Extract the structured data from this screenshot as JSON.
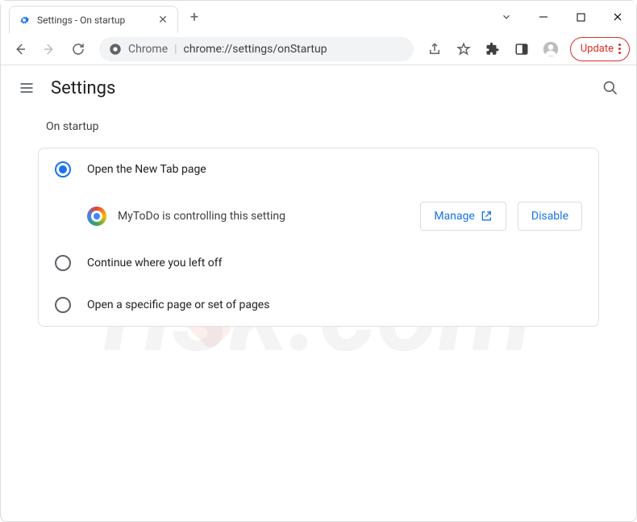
{
  "window": {
    "tab_title": "Settings - On startup"
  },
  "toolbar": {
    "chrome_prefix": "Chrome",
    "url": "chrome://settings/onStartup",
    "update_label": "Update"
  },
  "header": {
    "title": "Settings"
  },
  "section": {
    "label": "On startup",
    "options": [
      {
        "label": "Open the New Tab page",
        "selected": true
      },
      {
        "label": "Continue where you left off",
        "selected": false
      },
      {
        "label": "Open a specific page or set of pages",
        "selected": false
      }
    ],
    "extension_control": {
      "text": "MyToDo is controlling this setting",
      "manage_label": "Manage",
      "disable_label": "Disable"
    }
  }
}
